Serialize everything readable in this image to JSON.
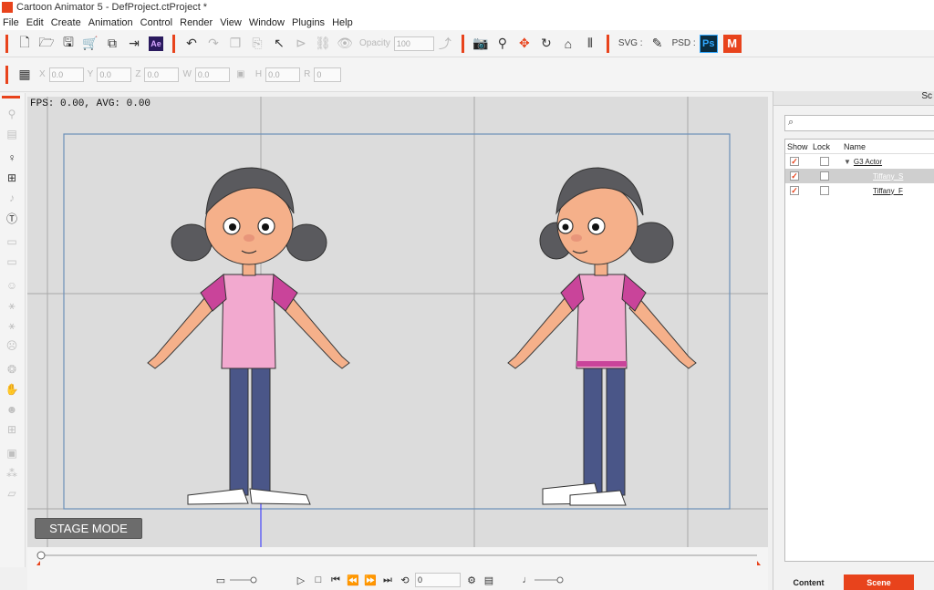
{
  "window": {
    "title": "Cartoon Animator 5 - DefProject.ctProject *"
  },
  "menu": [
    "File",
    "Edit",
    "Create",
    "Animation",
    "Control",
    "Render",
    "View",
    "Window",
    "Plugins",
    "Help"
  ],
  "toolbar": {
    "opacity_label": "Opacity",
    "opacity_value": "100",
    "svg_label": "SVG :",
    "psd_label": "PSD :",
    "ae_label": "Ae",
    "ps_label": "Ps",
    "m_label": "M"
  },
  "transform": {
    "x_label": "X",
    "x_value": "0.0",
    "y_label": "Y",
    "y_value": "0.0",
    "z_label": "Z",
    "z_value": "0.0",
    "w_label": "W",
    "w_value": "0.0",
    "h_label": "H",
    "h_value": "0.0",
    "r_label": "R",
    "r_value": "0"
  },
  "stage": {
    "fps_text": "FPS: 0.00, AVG: 0.00",
    "mode_button": "STAGE MODE"
  },
  "timeline": {
    "frame_value": "0"
  },
  "scene_panel": {
    "header": "Sc",
    "columns": {
      "show": "Show",
      "lock": "Lock",
      "name": "Name"
    },
    "rows": [
      {
        "name": "G3 Actor",
        "show": true,
        "lock": false,
        "selected": false,
        "expanded": true
      },
      {
        "name": "Tiffany_S",
        "show": true,
        "lock": false,
        "selected": true
      },
      {
        "name": "Tiffany_F",
        "show": true,
        "lock": false,
        "selected": false
      }
    ],
    "tabs": {
      "content": "Content",
      "scene": "Scene"
    }
  },
  "colors": {
    "accent": "#e8431c",
    "stage_bg": "#dcdcdc",
    "frame_border": "#6b8fb8"
  }
}
